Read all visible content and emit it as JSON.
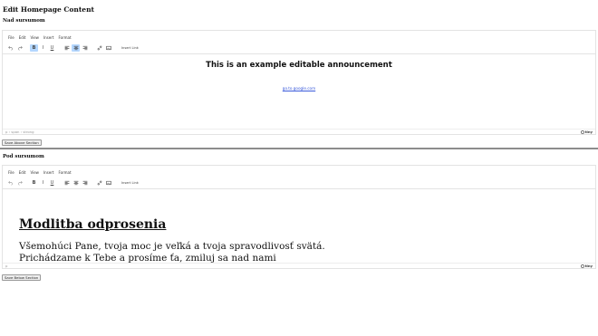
{
  "page": {
    "title": "Edit Homepage Content"
  },
  "menu": [
    "File",
    "Edit",
    "View",
    "Insert",
    "Format"
  ],
  "toolbar": {
    "insert_link": "Insert Link"
  },
  "editor_top": {
    "section_title": "Nad sursumom",
    "announcement_title": "This is an example editable announcement",
    "announcement_link": "go.to.google.com",
    "path": "p › span › strong",
    "brand": "tiny",
    "save_label": "Save Above Section"
  },
  "editor_bottom": {
    "section_title": "Pod sursumom",
    "heading": "Modlitba odprosenia",
    "line1": "Všemohúci Pane, tvoja moc je veľká a tvoja spravodlivosť svätá.",
    "line2": "Prichádzame k Tebe a prosíme ťa, zmiluj sa nad nami",
    "path": "p",
    "brand": "tiny",
    "save_label": "Save Below Section"
  }
}
